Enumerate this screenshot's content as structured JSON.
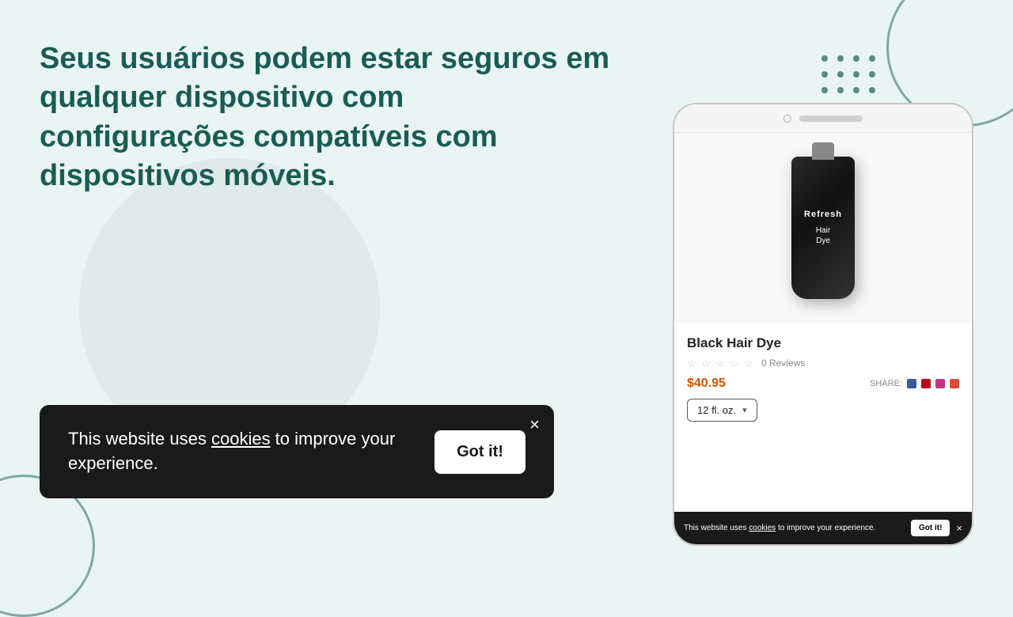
{
  "page": {
    "background_color": "#e8f5f3"
  },
  "headline": {
    "text": "Seus usuários podem estar seguros em qualquer dispositivo com configurações compatíveis com dispositivos móveis.",
    "color": "#1a5c54"
  },
  "cookie_banner": {
    "text_before_link": "This website uses ",
    "link_text": "cookies",
    "text_after_link": " to improve your experience.",
    "got_it_label": "Got it!",
    "close_symbol": "×"
  },
  "phone": {
    "product": {
      "brand": "Refresh",
      "name": "Hair\nDye",
      "title": "Black Hair Dye",
      "stars_empty": 5,
      "reviews_count": "0 Reviews",
      "price": "$40.95",
      "share_label": "SHARE:",
      "size_option": "12 fl. oz.",
      "size_chevron": "▾"
    },
    "mini_cookie": {
      "text_before_link": "This website uses ",
      "link_text": "cookies",
      "text_after_link": " to improve your experience.",
      "got_it_label": "Got it!",
      "close_symbol": "×"
    }
  },
  "decorative": {
    "dots_count": 12
  }
}
